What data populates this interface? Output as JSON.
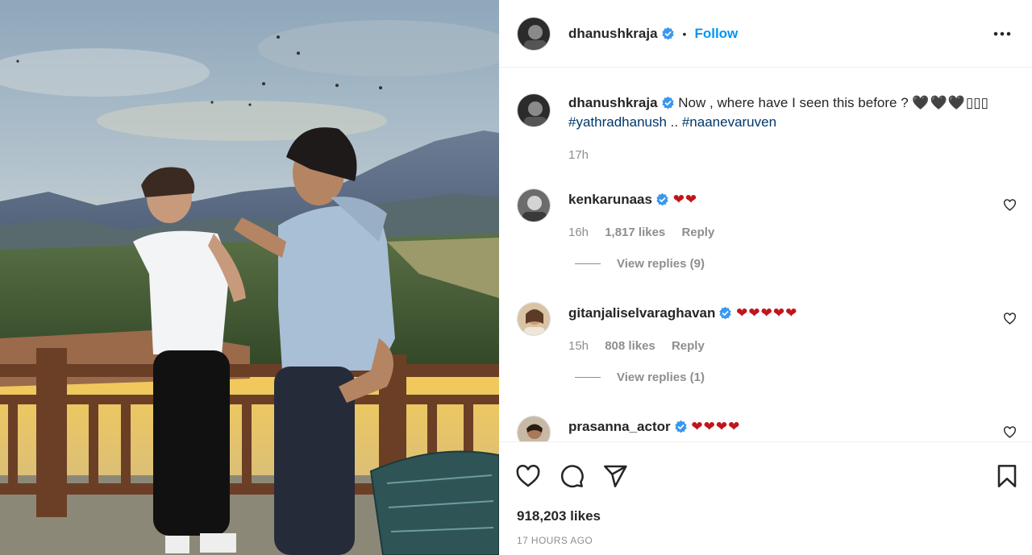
{
  "post": {
    "author": "dhanushkraja",
    "follow_label": "Follow",
    "dot": "•",
    "caption_text": "Now , where have I seen this before ? ",
    "caption_hearts": "🖤🖤🖤",
    "caption_emoji_extra": "▯▯▯",
    "hashtag1": "#yathradhanush",
    "hashtag_sep": " .. ",
    "hashtag2": "#naanevaruven",
    "caption_time": "17h",
    "likes": "918,203 likes",
    "time_ago": "17 HOURS AGO"
  },
  "comments": [
    {
      "user": "kenkarunaas",
      "hearts": "❤❤",
      "time": "16h",
      "likes": "1,817 likes",
      "reply": "Reply",
      "view_replies": "View replies (9)"
    },
    {
      "user": "gitanjaliselvaraghavan",
      "hearts": "❤❤❤❤❤",
      "time": "15h",
      "likes": "808 likes",
      "reply": "Reply",
      "view_replies": "View replies (1)"
    },
    {
      "user": "prasanna_actor",
      "hearts": "❤❤❤❤"
    }
  ],
  "icons": {
    "more": "more-options-icon",
    "like": "heart-icon",
    "comment": "comment-icon",
    "share": "share-icon",
    "save": "bookmark-icon",
    "verified": "verified-badge-icon"
  },
  "colors": {
    "accent": "#0095f6",
    "verified": "#3897f0",
    "heart": "#c0161b",
    "muted": "#8e8e8e"
  }
}
